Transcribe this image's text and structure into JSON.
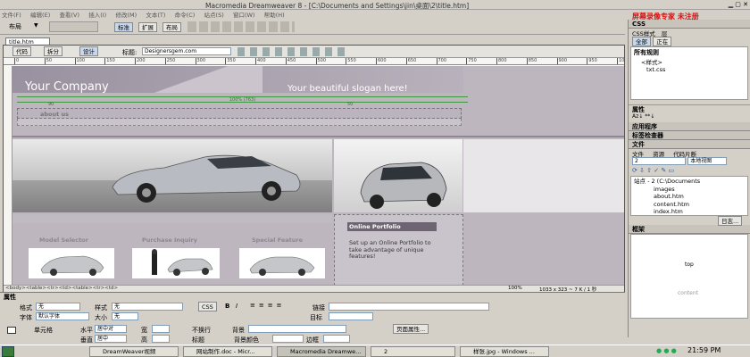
{
  "window": {
    "title": "Macromedia Dreamweaver 8 - [C:\\Documents and Settings\\jin\\桌面\\2\\title.htm]",
    "watermark": "屏幕录像专家 未注册"
  },
  "menu": [
    "文件(F)",
    "编辑(E)",
    "查看(V)",
    "插入(I)",
    "修改(M)",
    "文本(T)",
    "命令(C)",
    "站点(S)",
    "窗口(W)",
    "帮助(H)"
  ],
  "insert_bar": {
    "layout_label": "布局",
    "std_label": "标准",
    "expand_label": "扩展",
    "layout_btn": "布局"
  },
  "doc": {
    "tab": "title.htm",
    "code_label": "代码",
    "split_label": "拆分",
    "design_label": "设计",
    "title_label": "标题:",
    "title_value": "Designersgem.com",
    "status_path": "<body><table><tr><td><table><tr><td>",
    "zoom": "100%",
    "size_info": "1033 x 323 ~ 7 K / 1 秒"
  },
  "page": {
    "company": "Your Company",
    "slogan": "Your beautiful slogan here!",
    "nav": "about us",
    "width_label": "100% (763)",
    "col1": "90",
    "col2": "50",
    "sec1": "Model Selector",
    "sec2": "Purchase Inquiry",
    "sec3": "Special Feature",
    "portfolio_title": "Online Portfolio",
    "portfolio_text": "Set up an Online Portfolio to take advantage of unique features!"
  },
  "right": {
    "css_header": "CSS",
    "css_tab1": "CSS样式",
    "css_tab2": "层",
    "all_btn": "全部",
    "current_btn": "正在",
    "all_rules": "所有规则",
    "rule1": "<样式>",
    "rule2": "txt.css",
    "attr_header": "属性",
    "app_header": "应用程序",
    "tag_header": "标签检查器",
    "file_header": "文件",
    "file_tab1": "文件",
    "file_tab2": "资源",
    "file_tab3": "代码片断",
    "site_select": "2",
    "view_select": "本地视图",
    "tree": [
      "站点 - 2 (C:\\Documents",
      "images",
      "about.htm",
      "content.htm",
      "index.htm"
    ],
    "log_btn": "日志...",
    "frames_header": "框架",
    "frame_top": "top",
    "frame_content": "content"
  },
  "props": {
    "header": "属性",
    "format_label": "格式",
    "format_val": "无",
    "style_label": "样式",
    "style_val": "无",
    "css_btn": "CSS",
    "bold": "B",
    "italic": "I",
    "link_label": "链接",
    "font_label": "字体",
    "font_val": "默认字体",
    "size_label": "大小",
    "size_val": "无",
    "target_label": "目标",
    "cell_label": "单元格",
    "horz_label": "水平",
    "horz_val": "居中对",
    "vert_label": "垂直",
    "vert_val": "居中",
    "w_label": "宽",
    "h_label": "高",
    "nowrap_label": "不换行",
    "header_label": "标题",
    "bg_label": "背景",
    "bgcolor_label": "背景颜色",
    "border_label": "边框",
    "page_props_btn": "页面属性..."
  },
  "taskbar": {
    "items": [
      "DreamWeaver视频",
      "网站制作.doc - Micr...",
      "Macromedia Dreamwe...",
      "2",
      "样张.jpg - Windows ..."
    ],
    "clock": "21:59 PM"
  },
  "colors": {
    "accent": "#4a6fa5",
    "page_bg": "#bdb6bf",
    "header_bg": "#9a91a0"
  }
}
